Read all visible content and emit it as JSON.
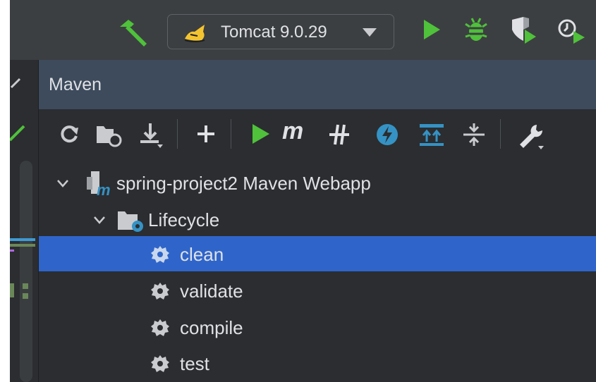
{
  "toolbar": {
    "run_config_label": "Tomcat 9.0.29",
    "icons": [
      "build-hammer-icon",
      "tomcat-icon",
      "chevron-down-icon",
      "run-icon",
      "debug-icon",
      "coverage-icon",
      "profile-icon"
    ]
  },
  "tool_window": {
    "title": "Maven"
  },
  "maven_toolbar": {
    "icons": [
      "reload-icon",
      "generate-sources-icon",
      "download-icon",
      "add-icon",
      "run-icon",
      "execute-goal-icon",
      "toggle-offline-icon",
      "skip-tests-icon",
      "show-dependencies-icon",
      "collapse-all-icon",
      "settings-icon"
    ],
    "execute_goal_glyph": "m"
  },
  "tree": {
    "project": "spring-project2 Maven Webapp",
    "lifecycle": "Lifecycle",
    "goals": [
      "clean",
      "validate",
      "compile",
      "test"
    ],
    "selected": "clean"
  },
  "colors": {
    "accent_green": "#4fc13b",
    "selection": "#2f65ca",
    "header": "#3d4b5c",
    "blue_icon": "#3592c4"
  }
}
